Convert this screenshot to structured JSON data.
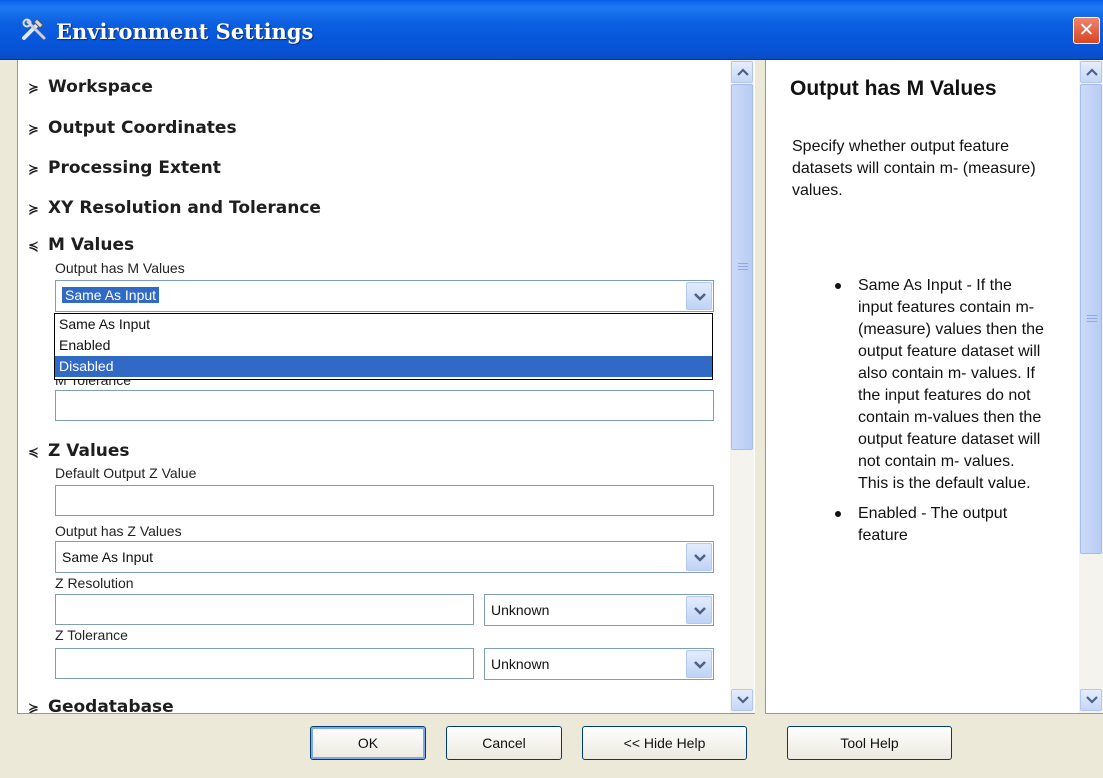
{
  "window": {
    "title": "Environment Settings",
    "close_glyph": "✕"
  },
  "sections": {
    "workspace": {
      "chev": "≽",
      "label": "Workspace"
    },
    "output_coordinates": {
      "chev": "≽",
      "label": "Output Coordinates"
    },
    "processing_extent": {
      "chev": "≽",
      "label": "Processing Extent"
    },
    "xy_resolution": {
      "chev": "≽",
      "label": "XY Resolution and Tolerance"
    },
    "m_values": {
      "chev": "≼",
      "label": "M Values"
    },
    "z_values": {
      "chev": "≼",
      "label": "Z Values"
    },
    "geodatabase": {
      "chev": "≽",
      "label": "Geodatabase"
    }
  },
  "m_values": {
    "output_has_m_label": "Output has M Values",
    "output_has_m_value": "Same As Input",
    "dropdown_options": [
      "Same As Input",
      "Enabled",
      "Disabled"
    ],
    "dropdown_selected": "Disabled",
    "m_tolerance_label": "M Tolerance",
    "m_tolerance_value": ""
  },
  "z_values": {
    "default_output_z_label": "Default Output Z Value",
    "default_output_z_value": "",
    "output_has_z_label": "Output has Z Values",
    "output_has_z_value": "Same As Input",
    "z_resolution_label": "Z Resolution",
    "z_resolution_value": "",
    "z_resolution_unit": "Unknown",
    "z_tolerance_label": "Z Tolerance",
    "z_tolerance_value": "",
    "z_tolerance_unit": "Unknown"
  },
  "help": {
    "title": "Output has M Values",
    "description": "Specify whether output feature datasets will contain m- (measure) values.",
    "bullets": [
      "Same As Input - If the input features contain m- (measure) values then the output feature dataset will also contain m- values. If the input features do not contain m-values then the output feature dataset will not contain m- values. This is the default value.",
      "Enabled - The output feature"
    ]
  },
  "buttons": {
    "ok": "OK",
    "cancel": "Cancel",
    "hide_help": "<< Hide Help",
    "tool_help": "Tool Help"
  },
  "colors": {
    "titlebar": "#0653d7",
    "selection": "#316ac5",
    "dialog_bg": "#ece9d8"
  },
  "icons": {
    "title_icon": "tools-icon",
    "close": "close-icon",
    "dropdown": "chevron-down-icon"
  }
}
